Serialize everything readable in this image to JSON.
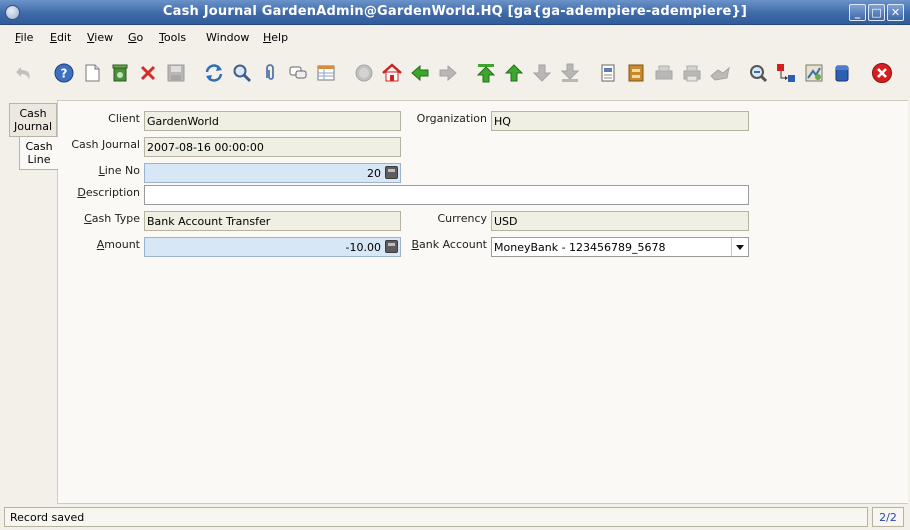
{
  "window": {
    "title": "Cash Journal  GardenAdmin@GardenWorld.HQ [ga{ga-adempiere-adempiere}]",
    "controls": {
      "minimize": "_",
      "maximize": "□",
      "close": "✕"
    }
  },
  "menu": {
    "items": [
      {
        "key": "F",
        "rest": "ile"
      },
      {
        "key": "E",
        "rest": "dit"
      },
      {
        "key": "V",
        "rest": "iew"
      },
      {
        "key": "G",
        "rest": "o"
      },
      {
        "key": "T",
        "rest": "ools"
      },
      {
        "key": "",
        "rest": "Window"
      },
      {
        "key": "H",
        "rest": "elp"
      }
    ]
  },
  "toolbar": {
    "icons": [
      "undo-icon",
      "help-icon",
      "new-record-icon",
      "delete-icon",
      "delete-selection-icon",
      "save-icon",
      "refresh-icon",
      "find-icon",
      "attachment-icon",
      "chat-icon",
      "grid-toggle-icon",
      "history-icon",
      "home-icon",
      "previous-tab-icon",
      "next-tab-icon",
      "first-record-icon",
      "previous-record-icon",
      "next-record-icon",
      "last-record-icon",
      "report-icon",
      "archive-icon",
      "print-preview-icon",
      "print-icon",
      "product-info-icon",
      "zoom-across-icon",
      "request-icon",
      "workflow-icon",
      "active-workflows-icon",
      "exit-icon"
    ]
  },
  "tabs": [
    {
      "line1": "Cash",
      "line2": "Journal"
    },
    {
      "line1": "Cash",
      "line2": "Line"
    }
  ],
  "form": {
    "client": {
      "label": "Client",
      "value": "GardenWorld"
    },
    "organization": {
      "label": "Organization",
      "value": "HQ"
    },
    "cash_journal": {
      "label": "Cash Journal",
      "value": "2007-08-16 00:00:00"
    },
    "line_no": {
      "label_key": "L",
      "label_rest": "ine No",
      "value": "20"
    },
    "description": {
      "label_key": "D",
      "label_rest": "escription",
      "value": ""
    },
    "cash_type": {
      "label_key": "C",
      "label_rest": "ash Type",
      "value": "Bank Account Transfer"
    },
    "currency": {
      "label": "Currency",
      "value": "USD"
    },
    "amount": {
      "label_key": "A",
      "label_rest": "mount",
      "value": "-10.00"
    },
    "bank_account": {
      "label_key": "B",
      "label_rest": "ank Account",
      "value": "MoneyBank - 123456789_5678"
    }
  },
  "status": {
    "message": "Record saved",
    "record_count": "2/2"
  }
}
